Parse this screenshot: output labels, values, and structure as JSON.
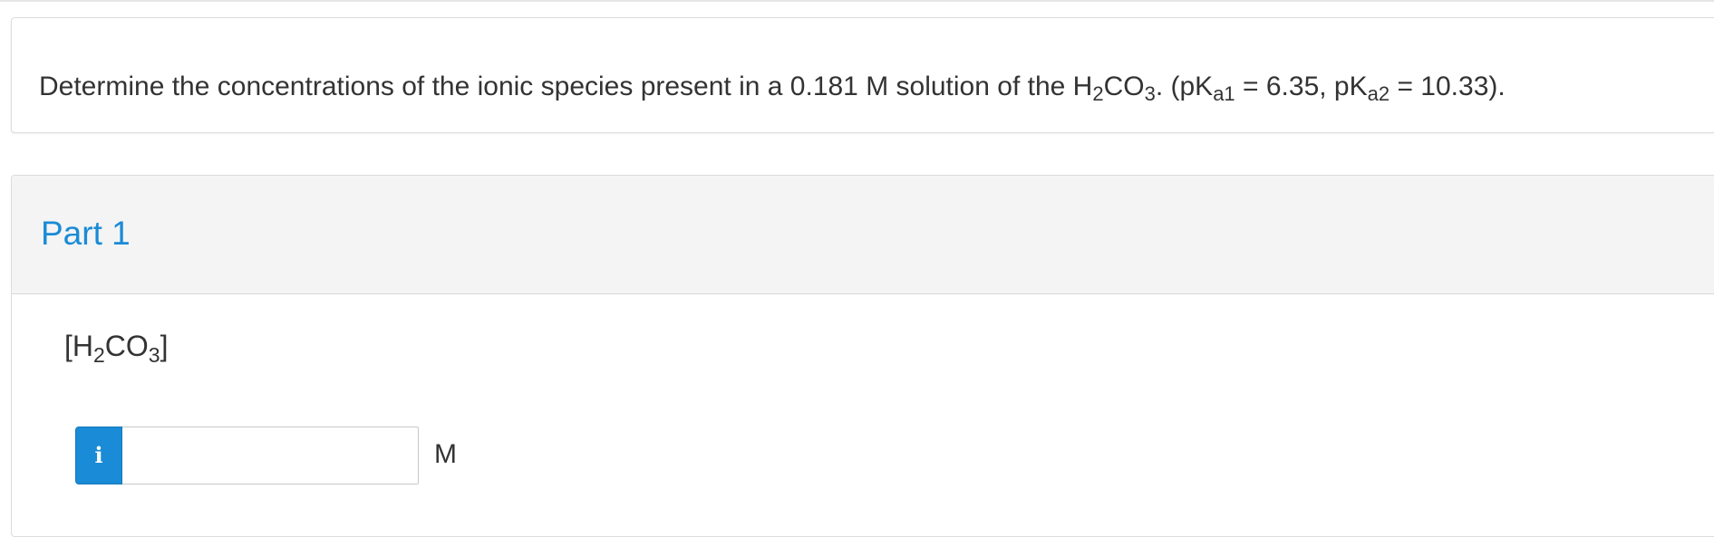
{
  "question": {
    "prefix": "Determine the concentrations of the ionic species present in a 0.181 M solution of the H",
    "formula_sub1": "2",
    "formula_mid": "CO",
    "formula_sub2": "3",
    "after_formula": ". (pK",
    "ka1_sub": "a1",
    "ka1_value": " = 6.35, pK",
    "ka2_sub": "a2",
    "ka2_value": " = 10.33)."
  },
  "part": {
    "title": "Part 1",
    "species": {
      "open": "[H",
      "sub1": "2",
      "mid": "CO",
      "sub2": "3",
      "close": "]"
    },
    "answer": {
      "info_icon": "info-icon",
      "info_glyph": "i",
      "value": "",
      "placeholder": "",
      "unit": "M"
    }
  },
  "colors": {
    "accent": "#1a8bd6",
    "header_bg": "#f4f4f4",
    "text": "#333333",
    "border": "#dcdcdc"
  }
}
